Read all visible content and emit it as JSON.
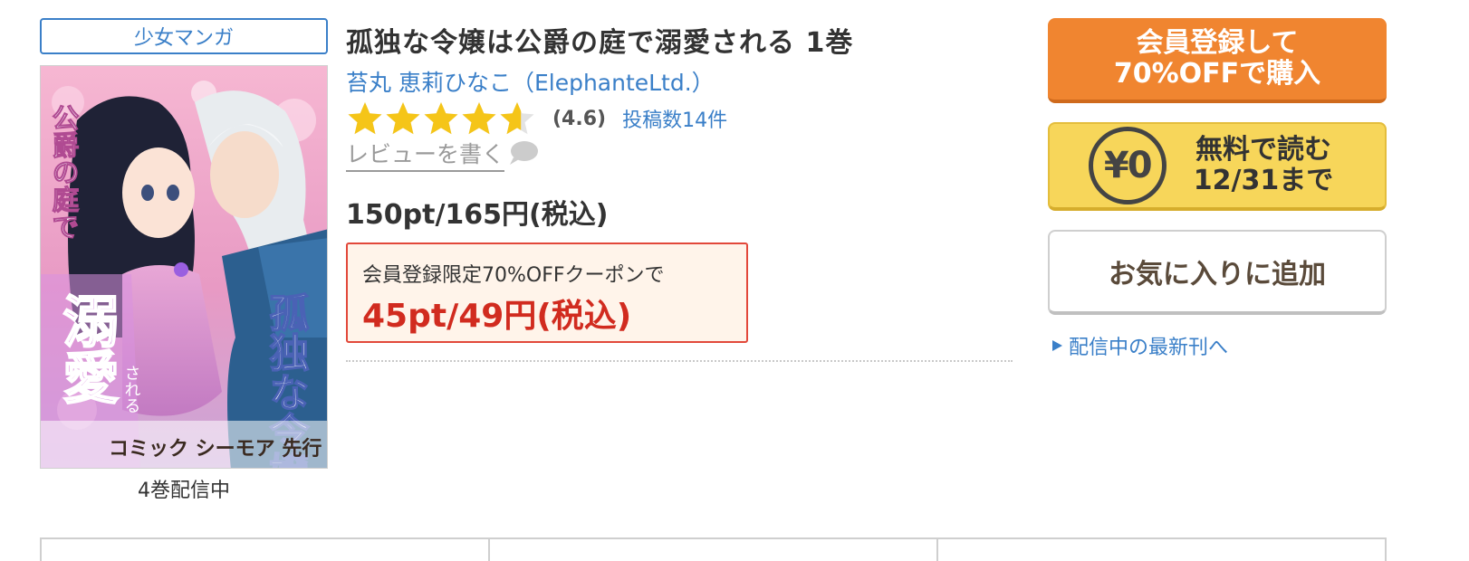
{
  "genre": {
    "label": "少女マンガ"
  },
  "cover": {
    "vertical_title_left": "公爵の庭で",
    "big_chars": "溺愛",
    "suffix": "される",
    "vertical_title_right": "孤独な令嬢",
    "publisher_label": "コミック シーモア 先行"
  },
  "volumes": {
    "label": "4巻配信中"
  },
  "book": {
    "title": "孤独な令嬢は公爵の庭で溺愛される 1巻",
    "author": "苔丸 恵莉ひなこ（ElephanteLtd.）",
    "rating": {
      "value": 4.6,
      "display": "(4.6)",
      "max": 5
    },
    "review_count_label": "投稿数14件",
    "write_review_label": "レビューを書く",
    "price_label": "150pt/165円(税込)",
    "coupon": {
      "label": "会員登録限定70%OFFクーポンで",
      "price": "45pt/49円(税込)"
    }
  },
  "actions": {
    "buy": {
      "line1": "会員登録して",
      "line2": "70%OFFで購入"
    },
    "free": {
      "icon_text": "¥0",
      "line1": "無料で読む",
      "line2": "12/31まで"
    },
    "favorite": {
      "label": "お気に入りに追加"
    },
    "latest_link": "配信中の最新刊へ"
  },
  "colors": {
    "link_blue": "#3a7fc8",
    "buy_orange": "#f08530",
    "free_yellow": "#f7d65a",
    "coupon_red": "#d12b1f",
    "star_gold": "#f5c518"
  },
  "icons": [
    "star-icon",
    "speech-bubble-icon",
    "yen-zero-icon",
    "triangle-right-icon"
  ]
}
